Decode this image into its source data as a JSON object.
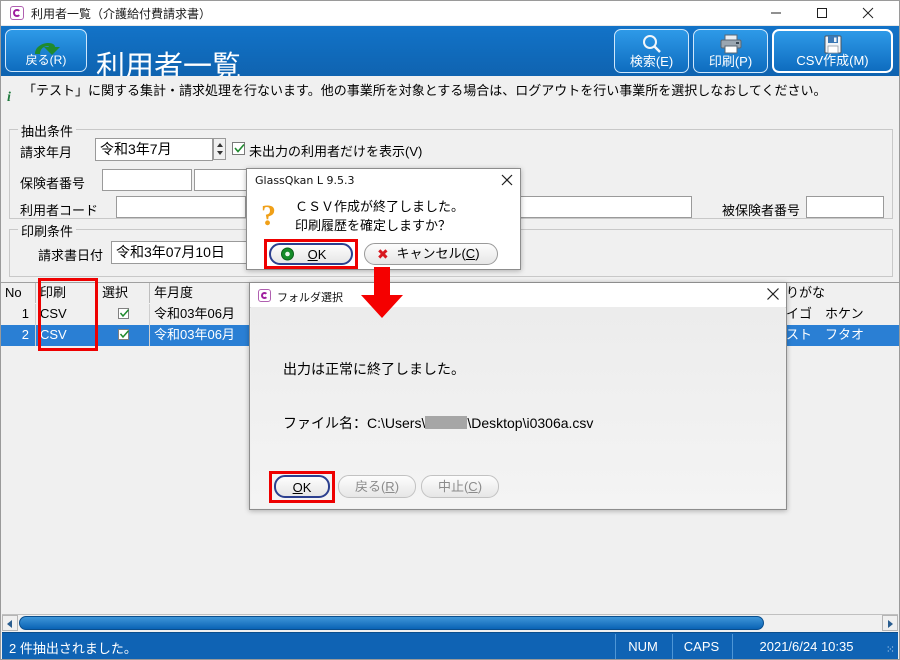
{
  "window": {
    "title": "利用者一覧（介護給付費請求書）",
    "icon": "app-icon",
    "minimize": "minimize-icon",
    "maximize": "maximize-icon",
    "close": "close-icon"
  },
  "header": {
    "back_label": "戻る(R)",
    "app_title": "利用者一覧",
    "buttons": [
      {
        "label": "検索(E)",
        "icon": "magnifier-icon"
      },
      {
        "label": "印刷(P)",
        "icon": "printer-icon"
      },
      {
        "label": "CSV作成(M)",
        "icon": "save-disk-icon"
      }
    ],
    "accent_color": "#0f63b4"
  },
  "info": {
    "icon": "info-icon",
    "text": "「テスト」に関する集計・請求処理を行ないます。他の事業所を対象とする場合は、ログアウトを行い事業所を選択しなおしてください。"
  },
  "extract": {
    "legend": "抽出条件",
    "seikyu_label": "請求年月",
    "seikyu_value": "令和3年7月",
    "checkbox_label": "未出力の利用者だけを表示(V)",
    "checkbox_checked": true,
    "hokensha_label": "保険者番号",
    "hokensha_value1": "",
    "hokensha_value2": "",
    "riyousha_label": "利用者コード",
    "riyousha_value": "",
    "hihokensha_label": "被保険者番号",
    "hihokensha_value": ""
  },
  "print_cond": {
    "legend": "印刷条件",
    "date_label": "請求書日付",
    "date_value": "令和3年07月10日"
  },
  "grid": {
    "columns": [
      "No",
      "印刷",
      "選択",
      "年月度",
      "りがな"
    ],
    "rows": [
      {
        "no": "1",
        "print": "CSV",
        "select": true,
        "period": "令和03年06月",
        "kana": "イゴ　ホケン",
        "selected": false
      },
      {
        "no": "2",
        "print": "CSV",
        "select": true,
        "period": "令和03年06月",
        "kana": "スト　フタオ",
        "selected": true
      }
    ]
  },
  "dialog_confirm": {
    "title": "GlassQkan L 9.5.3",
    "icon": "question-icon",
    "line1": "ＣＳＶ作成が終了しました。",
    "line2": "印刷履歴を確定しますか？",
    "ok_label": "OK",
    "cancel_label": "キャンセル(C)",
    "close": "close-icon"
  },
  "dialog_folder": {
    "title": "フォルダ選択",
    "icon": "app-icon",
    "message": "出力は正常に終了しました。",
    "file_prefix": "ファイル名：C:\\Users\\",
    "file_suffix": "\\Desktop\\i0306a.csv",
    "ok_label": "OK",
    "back_label": "戻る(R)",
    "stop_label": "中止(C)",
    "close": "close-icon"
  },
  "statusbar": {
    "message": "2 件抽出されました。",
    "num": "NUM",
    "caps": "CAPS",
    "datetime": "2021/6/24 10:35"
  },
  "annotations": {
    "arrow": "red-down-arrow",
    "highlight_color": "#ee0000"
  }
}
